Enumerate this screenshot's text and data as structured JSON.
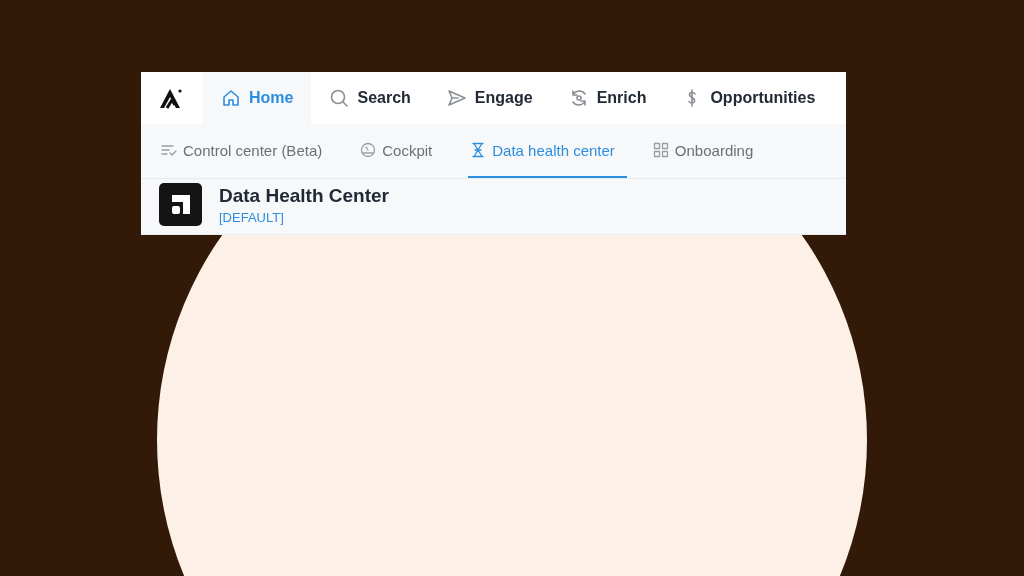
{
  "main_tabs": [
    {
      "label": "Home",
      "selected": true
    },
    {
      "label": "Search",
      "selected": false
    },
    {
      "label": "Engage",
      "selected": false
    },
    {
      "label": "Enrich",
      "selected": false
    },
    {
      "label": "Opportunities",
      "selected": false
    }
  ],
  "sub_tabs": [
    {
      "label": "Control center (Beta)",
      "selected": false
    },
    {
      "label": "Cockpit",
      "selected": false
    },
    {
      "label": "Data health center",
      "selected": true
    },
    {
      "label": "Onboarding",
      "selected": false
    }
  ],
  "page_header": {
    "title": "Data Health Center",
    "subtitle": "[DEFAULT]"
  }
}
